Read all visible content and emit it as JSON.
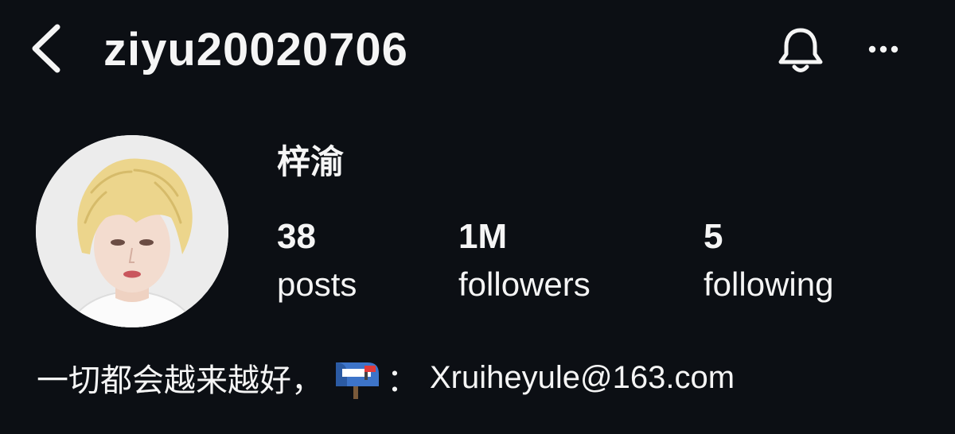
{
  "header": {
    "username": "ziyu20020706",
    "back_icon": "chevron-left-icon",
    "bell_icon": "bell-icon",
    "more_icon": "more-horizontal-icon"
  },
  "profile": {
    "display_name": "梓渝",
    "avatar_icon": "profile-avatar"
  },
  "stats": {
    "posts": {
      "count": "38",
      "label": "posts"
    },
    "followers": {
      "count": "1M",
      "label": "followers"
    },
    "following": {
      "count": "5",
      "label": "following"
    }
  },
  "bio": {
    "text": "一切都会越来越好，",
    "mailbox_icon": "mailbox-icon",
    "separator": "：",
    "email": "Xruiheyule@163.com"
  },
  "colors": {
    "background": "#0c0f14",
    "text": "#f5f5f5"
  }
}
